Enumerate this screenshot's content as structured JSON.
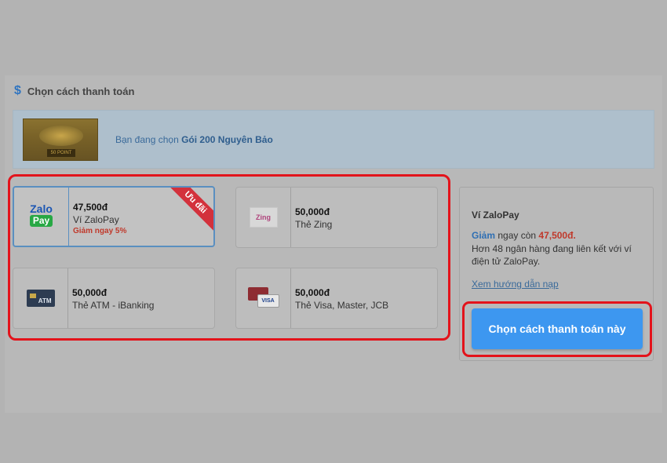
{
  "section": {
    "icon": "dollar-icon",
    "title": "Chọn cách thanh toán"
  },
  "banner": {
    "prefix": "Bạn đang chọn",
    "package": "Gói 200 Nguyên Bảo",
    "thumb_tag": "50 POINT"
  },
  "methods": [
    {
      "amount": "47,500đ",
      "name": "Ví ZaloPay",
      "promo": "Giảm ngay 5%",
      "ribbon": "Ưu đãi",
      "logo": "zalopay-logo",
      "logo_text_top": "Zalo",
      "logo_text_bottom": "Pay"
    },
    {
      "amount": "50,000đ",
      "name": "Thẻ Zing",
      "logo": "zing-logo",
      "logo_text": "Zing"
    },
    {
      "amount": "50,000đ",
      "name": "Thẻ ATM - iBanking",
      "logo": "atm-card-icon",
      "logo_text": "ATM"
    },
    {
      "amount": "50,000đ",
      "name": "Thẻ Visa, Master, JCB",
      "logo": "visa-master-card-icon",
      "logo_text": "VISA"
    }
  ],
  "detail": {
    "title": "Ví ZaloPay",
    "discount_label": "Giảm",
    "discount_mid": "ngay còn",
    "discount_price": "47,500đ.",
    "description": "Hơn 48 ngân hàng đang liên kết với ví điện tử ZaloPay.",
    "guide_link": "Xem hướng dẫn nạp",
    "confirm_label": "Chọn cách thanh toán này"
  },
  "colors": {
    "highlight_frame": "#e3131b",
    "confirm_button": "#3d97f0",
    "promo_red": "#c0392b",
    "link_blue": "#3a6a9a"
  }
}
